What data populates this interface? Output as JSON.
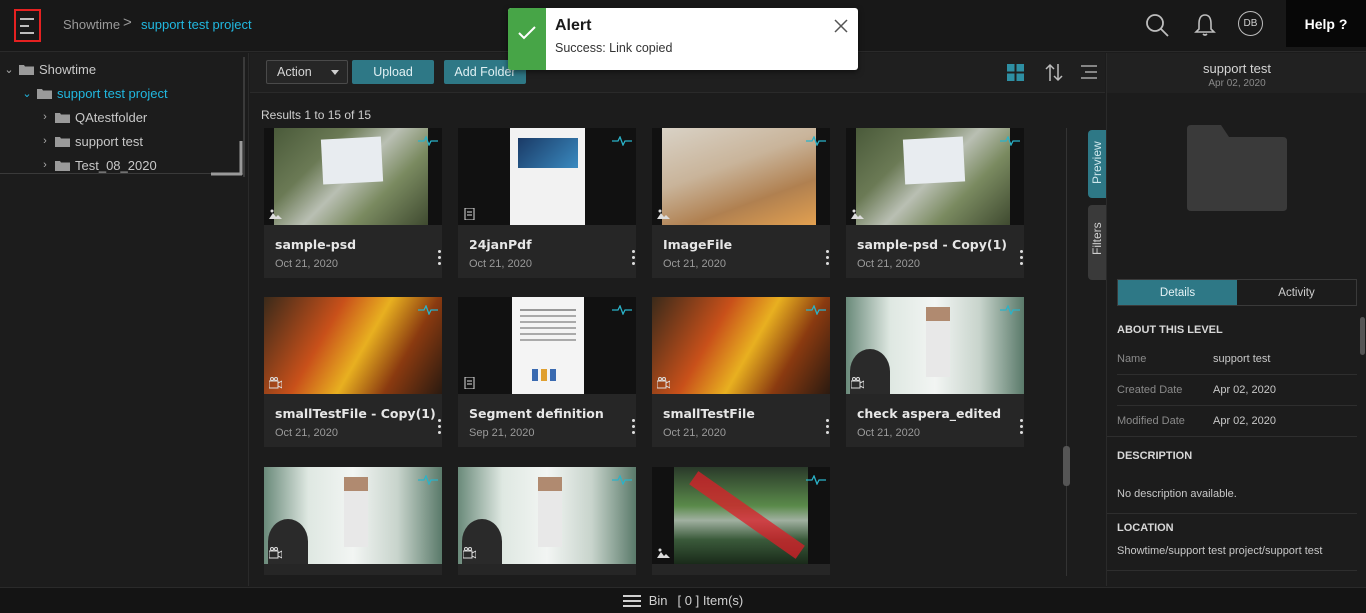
{
  "header": {
    "breadcrumb": [
      "Showtime",
      "support test project"
    ],
    "breadcrumb_separator": ">",
    "user_initials": "DB",
    "help_label": "Help ?"
  },
  "alert": {
    "title": "Alert",
    "message": "Success: Link copied",
    "accent": "#47a547"
  },
  "tree": {
    "items": [
      {
        "label": "Showtime",
        "expanded": true,
        "level": 0
      },
      {
        "label": "support test project",
        "expanded": true,
        "level": 1,
        "selected": true
      },
      {
        "label": "QAtestfolder",
        "expanded": false,
        "level": 2
      },
      {
        "label": "support test",
        "expanded": false,
        "level": 2
      },
      {
        "label": "Test_08_2020",
        "expanded": false,
        "level": 2
      }
    ]
  },
  "toolbar": {
    "action_label": "Action",
    "upload_label": "Upload",
    "add_folder_label": "Add Folder"
  },
  "results_label": "Results 1 to 15 of 15",
  "assets": [
    {
      "title": "sample-psd",
      "date": "Oct 21, 2020",
      "type": "image"
    },
    {
      "title": "24janPdf",
      "date": "Oct 21, 2020",
      "type": "document"
    },
    {
      "title": "ImageFile",
      "date": "Oct 21, 2020",
      "type": "image"
    },
    {
      "title": "sample-psd - Copy(1)",
      "date": "Oct 21, 2020",
      "type": "image"
    },
    {
      "title": "smallTestFile - Copy(1)",
      "date": "Oct 21, 2020",
      "type": "video"
    },
    {
      "title": "Segment definition",
      "date": "Sep 21, 2020",
      "type": "document"
    },
    {
      "title": "smallTestFile",
      "date": "Oct 21, 2020",
      "type": "video"
    },
    {
      "title": "check aspera_edited",
      "date": "Oct 21, 2020",
      "type": "video"
    },
    {
      "title": "",
      "date": "",
      "type": "video"
    },
    {
      "title": "",
      "date": "",
      "type": "video"
    },
    {
      "title": "",
      "date": "",
      "type": "image"
    }
  ],
  "side_tabs": {
    "preview": "Preview",
    "filters": "Filters"
  },
  "right_panel": {
    "name": "support test",
    "date": "Apr 02, 2020",
    "tabs": [
      "Details",
      "Activity"
    ],
    "about_heading": "ABOUT THIS LEVEL",
    "fields": [
      {
        "key": "Name",
        "value": "support test"
      },
      {
        "key": "Created Date",
        "value": "Apr 02, 2020"
      },
      {
        "key": "Modified Date",
        "value": "Apr 02, 2020"
      }
    ],
    "description_heading": "DESCRIPTION",
    "description": "No description available.",
    "location_heading": "LOCATION",
    "location": "Showtime/support test project/support test"
  },
  "bottom": {
    "bin_label": "Bin",
    "bin_count": "[ 0 ] Item(s)"
  },
  "colors": {
    "accent": "#2e7886",
    "link": "#21b8e0",
    "pulse": "#2ab3c9"
  }
}
